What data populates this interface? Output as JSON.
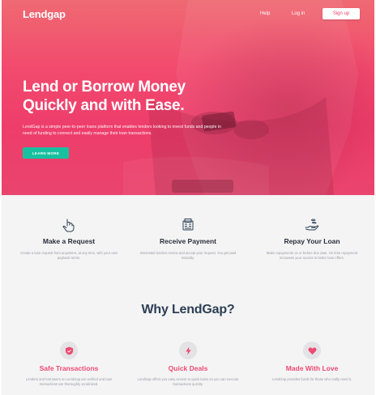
{
  "brand": {
    "logo": "Lendgap",
    "accent": "#ee4a72",
    "cta_color": "#17c1a0"
  },
  "nav": {
    "help": "Help",
    "login": "Log in",
    "signup": "Sign up"
  },
  "hero": {
    "title_line1": "Lend or Borrow Money",
    "title_line2": "Quickly and with Ease.",
    "description": "LendGap is a simple peer-to-peer loans platform that enables lenders looking to invest funds and people in need of funding to connect and easily manage their loan transactions.",
    "cta": "LEARN MORE"
  },
  "steps": [
    {
      "icon": "hand-pointer-icon",
      "title": "Make a Request",
      "desc": "Create a loan request from anywhere, at any time, with your own payback terms."
    },
    {
      "icon": "cash-register-icon",
      "title": "Receive Payment",
      "desc": "Interested lenders review and accept your request. You get paid instantly."
    },
    {
      "icon": "hand-holding-money-icon",
      "title": "Repay Your Loan",
      "desc": "Make repayments on or before due date. On time repayment increases your access to better loan offers."
    }
  ],
  "why": {
    "title": "Why LendGap?",
    "items": [
      {
        "icon": "shield-icon",
        "title": "Safe Transactions",
        "desc": "Lenders and borrowers on LendGap are verified and loan transactions are thoroughly scrutinized."
      },
      {
        "icon": "lightning-icon",
        "title": "Quick Deals",
        "desc": "LendGap offers you easy access to quick loans so you can execute transactions quickly."
      },
      {
        "icon": "heart-icon",
        "title": "Made With Love",
        "desc": "LendGap provides funds for those who really need it."
      }
    ]
  }
}
